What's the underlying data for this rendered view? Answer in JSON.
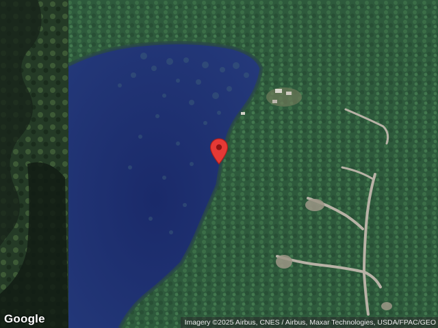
{
  "map": {
    "type": "satellite",
    "provider_logo": "Google",
    "attribution": "Imagery ©2025 Airbus, CNES / Airbus, Maxar Technologies, USDA/FPAC/GEO",
    "marker": {
      "icon": "map-pin-icon",
      "color": "#e53935"
    },
    "colors": {
      "water": "#1e2f6e",
      "forest": "#2f5d3c",
      "road": "#b8b2a6"
    }
  }
}
